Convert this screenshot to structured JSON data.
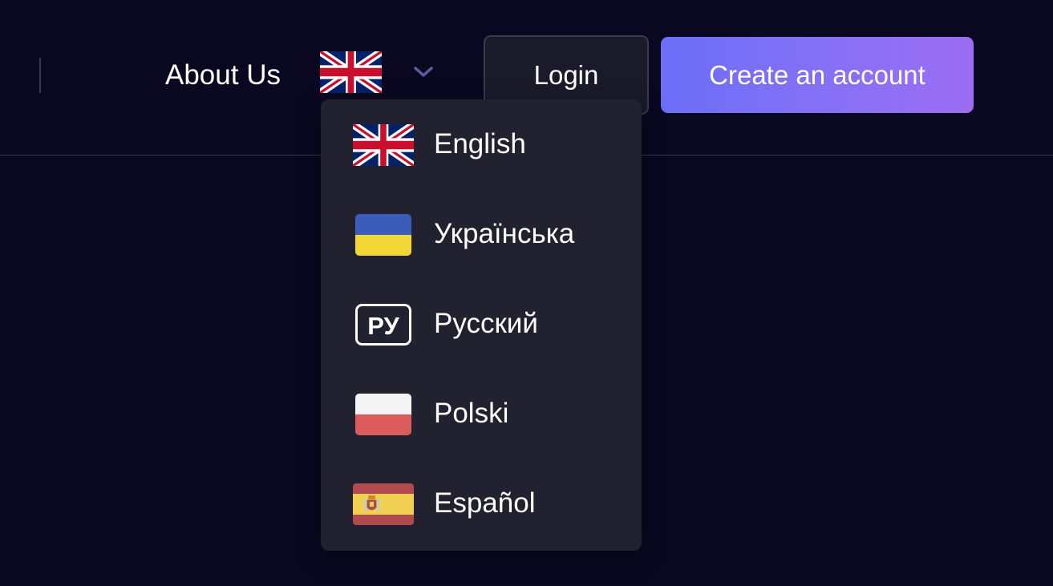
{
  "header": {
    "about_label": "About Us",
    "current_language_icon": "uk-flag-icon",
    "chevron_icon": "chevron-down-icon",
    "login_label": "Login",
    "create_account_label": "Create an account"
  },
  "language_menu": {
    "items": [
      {
        "label": "English",
        "icon": "uk-flag-icon"
      },
      {
        "label": "Українська",
        "icon": "ukraine-flag-icon"
      },
      {
        "label": "Русский",
        "icon": "ru-badge-icon",
        "badge_text": "РУ"
      },
      {
        "label": "Polski",
        "icon": "poland-flag-icon"
      },
      {
        "label": "Español",
        "icon": "spain-flag-icon"
      }
    ]
  },
  "colors": {
    "background": "#0a0820",
    "menu_background": "#21212f",
    "login_background": "#1b1a2b",
    "accent_gradient_start": "#6b6ff8",
    "accent_gradient_end": "#9b6df2",
    "chevron": "#5a5f9a"
  }
}
